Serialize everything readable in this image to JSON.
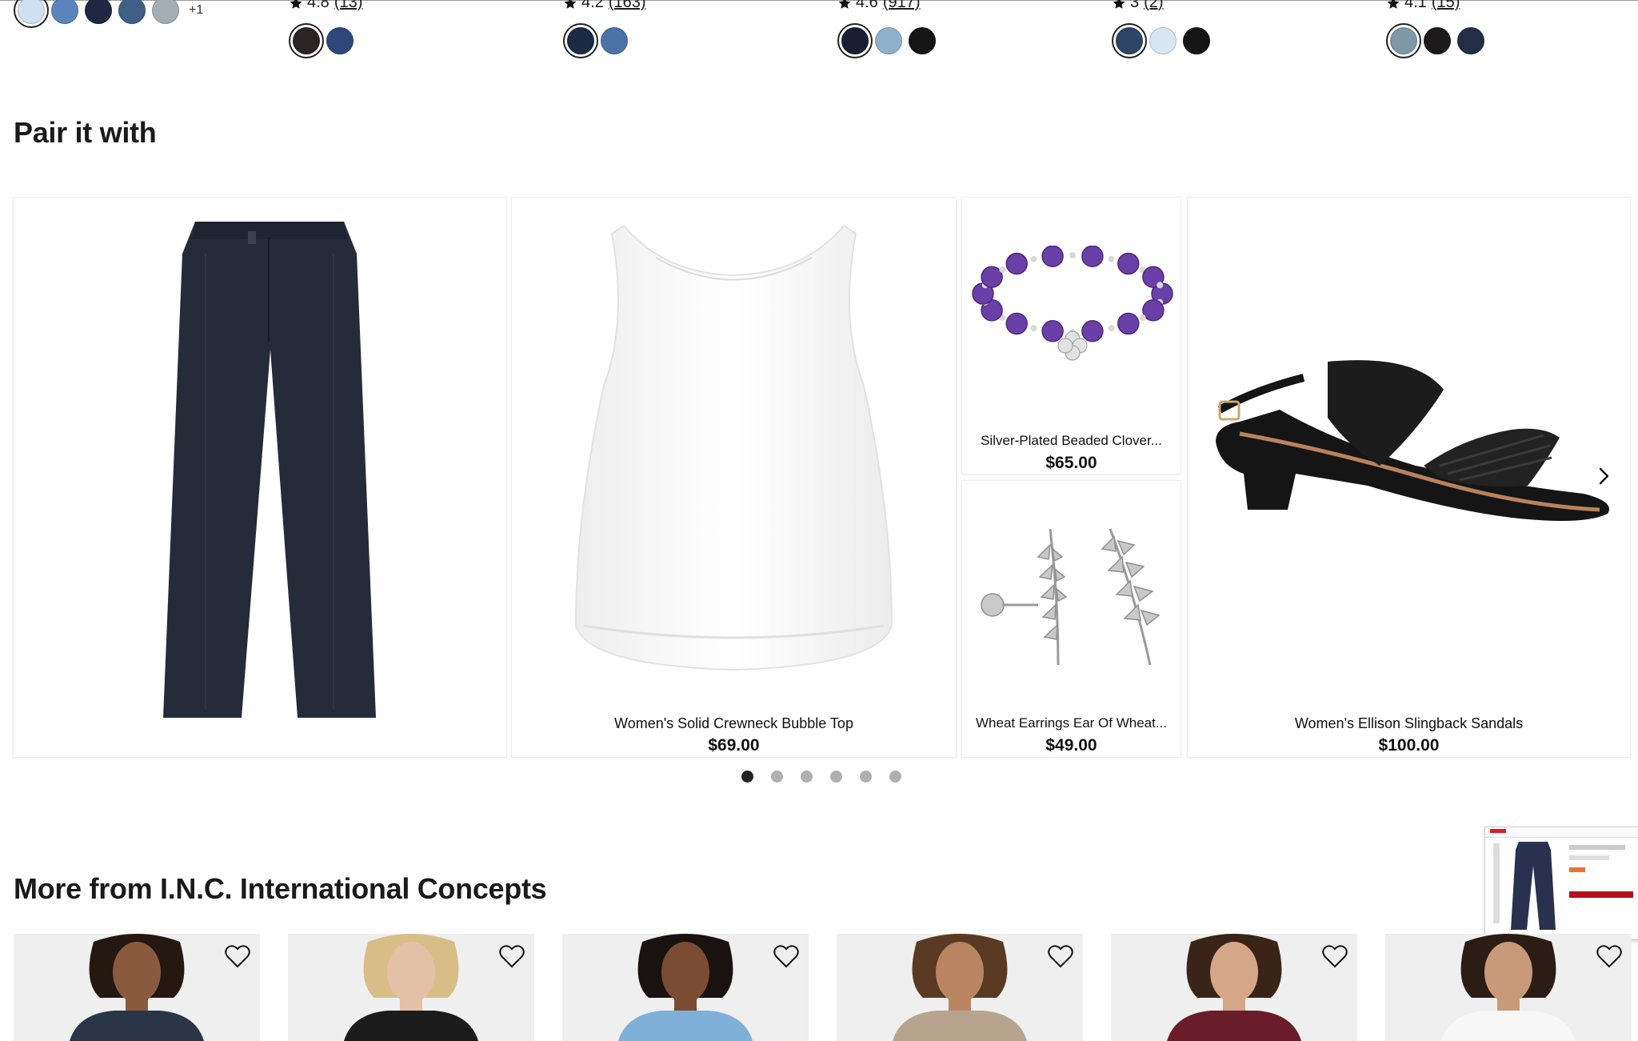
{
  "top_strip": {
    "columns": [
      {
        "swatches": [
          "#cfe0f2",
          "#5b84bf",
          "#1f2742",
          "#3f5f86",
          "#a3adb3"
        ],
        "selected": 0,
        "more": "+1"
      },
      {
        "rating": "4.8",
        "count": "(13)",
        "swatches": [
          "#2a2424",
          "#2e4779"
        ],
        "selected": 0
      },
      {
        "rating": "4.2",
        "count": "(163)",
        "swatches": [
          "#1d2a45",
          "#4c73a8"
        ],
        "selected": 0
      },
      {
        "rating": "4.6",
        "count": "(917)",
        "swatches": [
          "#191e33",
          "#8fb2cc",
          "#151515"
        ],
        "selected": 0
      },
      {
        "rating": "3",
        "count": "(2)",
        "swatches": [
          "#2d4566",
          "#d8e6f2",
          "#151515"
        ],
        "selected": 0
      },
      {
        "rating": "4.1",
        "count": "(15)",
        "swatches": [
          "#7f98a6",
          "#1c1a1a",
          "#232e45"
        ],
        "selected": 0
      }
    ]
  },
  "pair_section": {
    "title": "Pair it with",
    "items": [
      {
        "icon": "pants-image"
      },
      {
        "name": "Women's Solid Crewneck Bubble Top",
        "price": "$69.00",
        "icon": "top-image"
      },
      {
        "name": "Silver-Plated Beaded Clover...",
        "price": "$65.00",
        "icon": "bracelet-image"
      },
      {
        "name": "Wheat Earrings Ear Of Wheat...",
        "price": "$49.00",
        "icon": "earrings-image"
      },
      {
        "name": "Women's Ellison Slingback Sandals",
        "price": "$100.00",
        "icon": "sandal-image"
      }
    ],
    "pagination": {
      "total": 6,
      "active": 0
    }
  },
  "more_section": {
    "title": "More from I.N.C. International Concepts",
    "cards": [
      {
        "top_color": "#2a3648",
        "skin": "#8a5a3f",
        "hair": "#241811"
      },
      {
        "top_color": "#1c1c1c",
        "skin": "#e3c0a6",
        "hair": "#d9bd86"
      },
      {
        "top_color": "#7fb0d8",
        "skin": "#7a4c34",
        "hair": "#1a1210"
      },
      {
        "top_color": "#b8a48e",
        "skin": "#b98562",
        "hair": "#5a3a23"
      },
      {
        "top_color": "#6b1c2a",
        "skin": "#d6a688",
        "hair": "#3a2418"
      },
      {
        "top_color": "#f7f7f7",
        "skin": "#c89a7a",
        "hair": "#2c1d14"
      }
    ]
  },
  "colors": {
    "accent": "#e21a22"
  }
}
